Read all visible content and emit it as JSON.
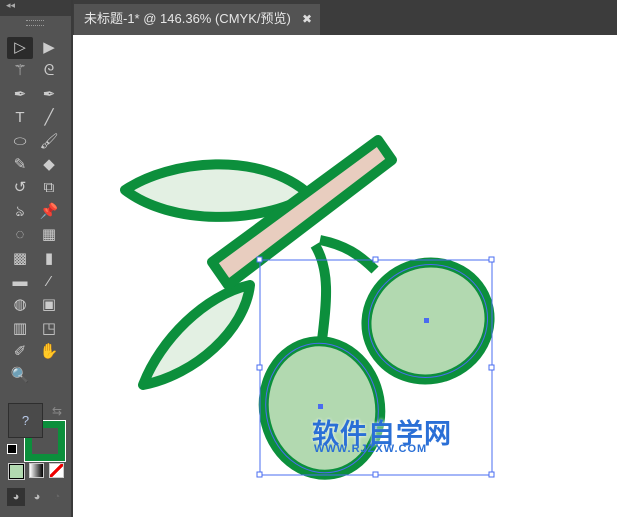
{
  "document_tab": {
    "title": "未标题-1* @ 146.36% (CMYK/预览)",
    "close": "✖"
  },
  "toolbar": {
    "collapse": "◂◂",
    "tools": [
      {
        "name": "selection-tool",
        "glyph": "▷"
      },
      {
        "name": "direct-selection-tool",
        "glyph": "▶"
      },
      {
        "name": "magic-wand-tool",
        "glyph": "⚚"
      },
      {
        "name": "lasso-tool",
        "glyph": "ᘓ"
      },
      {
        "name": "pen-tool",
        "glyph": "✒"
      },
      {
        "name": "curvature-tool",
        "glyph": "✒"
      },
      {
        "name": "type-tool",
        "glyph": "T"
      },
      {
        "name": "line-tool",
        "glyph": "╱"
      },
      {
        "name": "ellipse-tool",
        "glyph": "⬭"
      },
      {
        "name": "paintbrush-tool",
        "glyph": "🖌"
      },
      {
        "name": "pencil-tool",
        "glyph": "✎"
      },
      {
        "name": "eraser-tool",
        "glyph": "◆"
      },
      {
        "name": "rotate-tool",
        "glyph": "↺"
      },
      {
        "name": "scale-tool",
        "glyph": "⧉"
      },
      {
        "name": "warp-tool",
        "glyph": "ঌ"
      },
      {
        "name": "puppet-warp-tool",
        "glyph": "📌"
      },
      {
        "name": "shape-builder-tool",
        "glyph": "◌"
      },
      {
        "name": "perspective-grid-tool",
        "glyph": "▦"
      },
      {
        "name": "mesh-tool",
        "glyph": "▩"
      },
      {
        "name": "gradient-tool",
        "glyph": "▮"
      },
      {
        "name": "measure-tool",
        "glyph": "▬"
      },
      {
        "name": "eyedropper-tool",
        "glyph": "⁄"
      },
      {
        "name": "blend-tool",
        "glyph": "◍"
      },
      {
        "name": "symbol-sprayer-tool",
        "glyph": "▣"
      },
      {
        "name": "column-graph-tool",
        "glyph": "▥"
      },
      {
        "name": "artboard-tool",
        "glyph": "◳"
      },
      {
        "name": "slice-tool",
        "glyph": "✐"
      },
      {
        "name": "hand-tool",
        "glyph": "✋"
      },
      {
        "name": "zoom-tool",
        "glyph": "🔍"
      }
    ],
    "fill_unknown": "?"
  },
  "colors": {
    "stroke": "#0c8f3c",
    "cherry": "#b2d9b0",
    "leaf": "#e3f0e3",
    "stem": "#e8cdbf",
    "selection": "#4a6cf0"
  },
  "watermark": {
    "title": "软件自学网",
    "url": "WWW.RJZXW.COM"
  }
}
